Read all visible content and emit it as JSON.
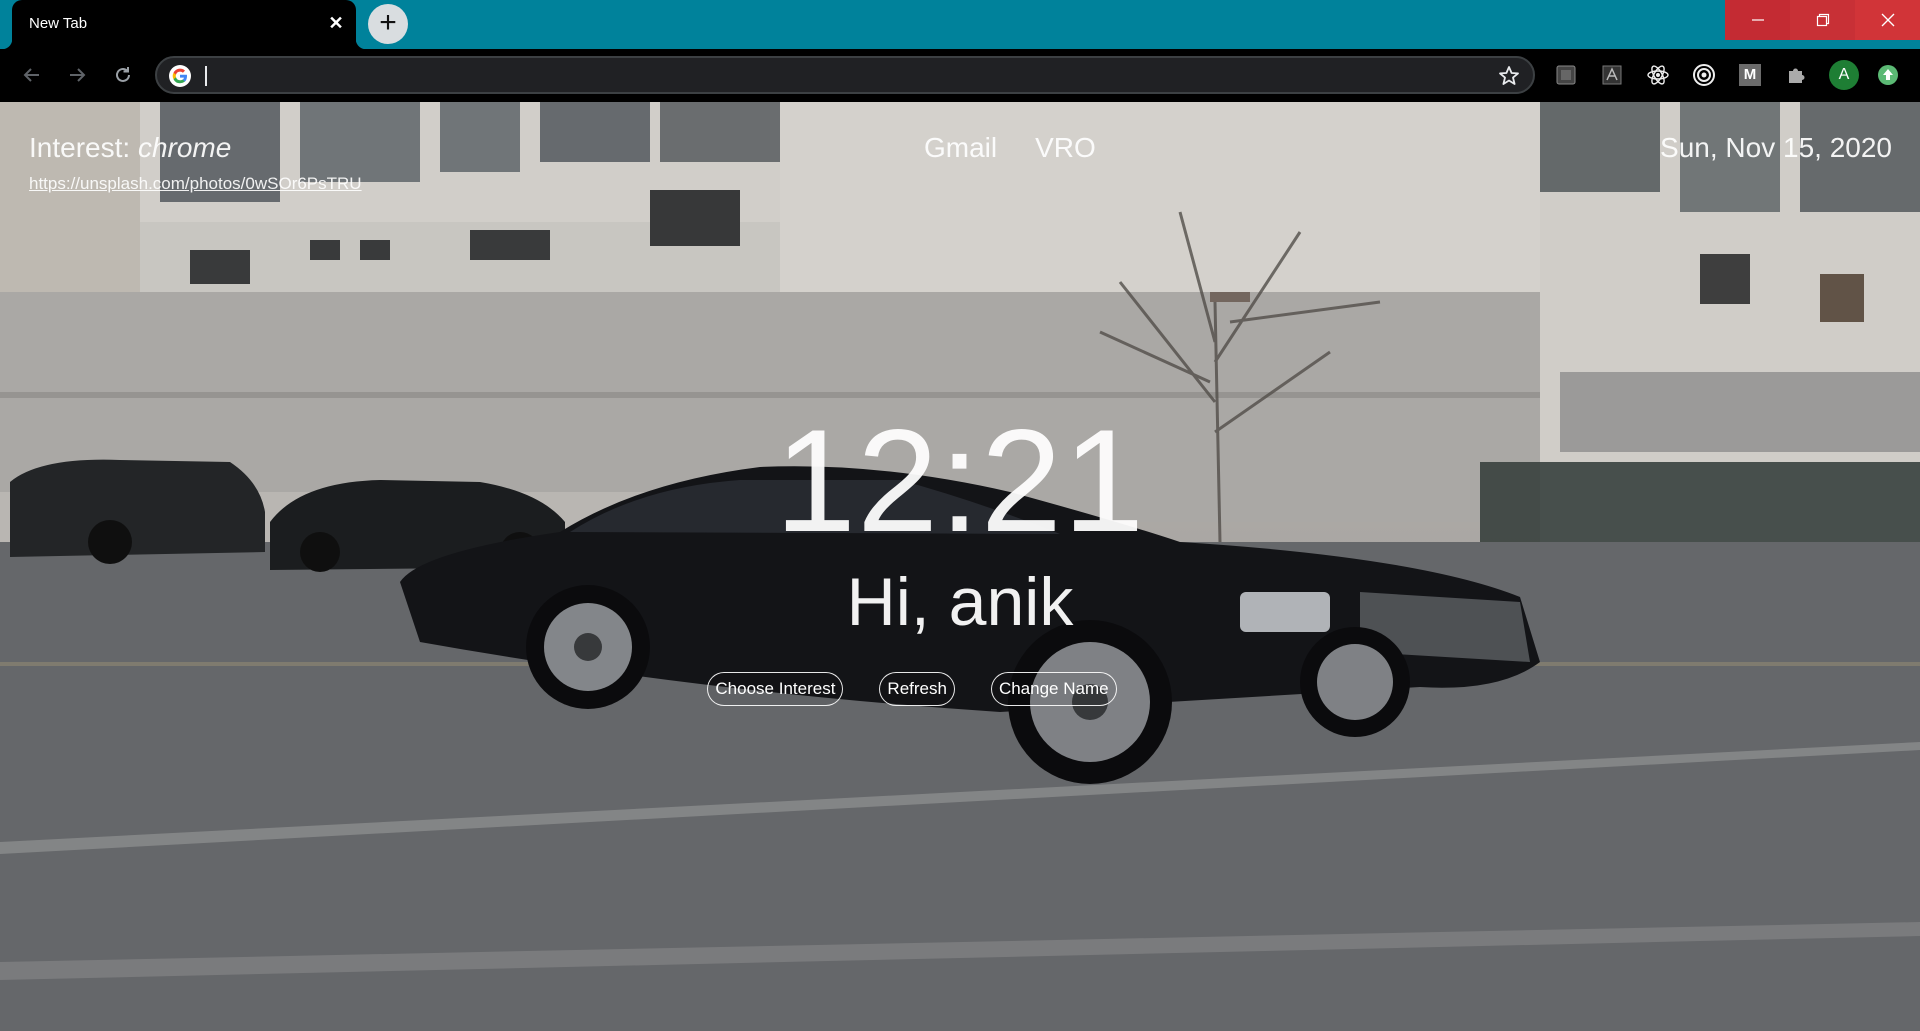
{
  "browser": {
    "tab_title": "New Tab",
    "tab_close": "✕",
    "new_tab_symbol": "+",
    "omnibox_value": "",
    "extensions": [
      "tab-manager-icon",
      "pdf-icon",
      "react-devtools-icon",
      "target-icon",
      "m-extension-icon",
      "puzzle-icon",
      "profile-avatar",
      "update-icon"
    ],
    "profile_initial": "A",
    "m_letter": "M",
    "colors": {
      "titlebar": "#00829b",
      "close_button": "#d13438",
      "toolbar": "#000000"
    }
  },
  "newtab": {
    "interest_label": "Interest: ",
    "interest_value": "chrome",
    "photo_url": "https://unsplash.com/photos/0wSOr6PsTRU",
    "links": [
      "Gmail",
      "VRO"
    ],
    "date": "Sun, Nov 15, 2020",
    "time": "12:21",
    "greeting": "Hi, anik",
    "buttons": [
      "Choose Interest",
      "Refresh",
      "Change Name"
    ]
  }
}
